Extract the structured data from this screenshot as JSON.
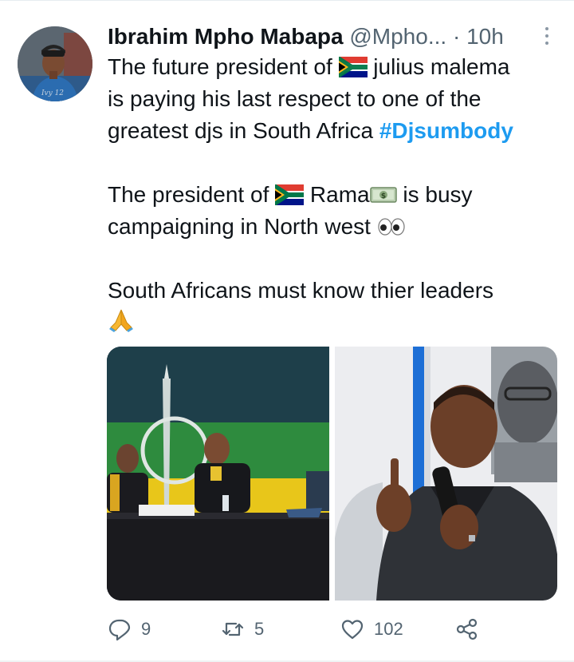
{
  "tweet": {
    "author_name": "Ibrahim Mpho Mabapa",
    "author_handle": "@Mpho...",
    "separator": "·",
    "time": "10h",
    "line1_before": "The future president of",
    "line1_after": "julius malema",
    "line2": "is paying his last respect to one of the",
    "line3_before": "greatest djs in South Africa",
    "hashtag": "#Djsumbody",
    "line4_before": "The president of",
    "line4_mid": "Rama",
    "line4_after": "is busy",
    "line5": "campaigning in North west",
    "line6": "South Africans must know thier leaders"
  },
  "emoji": {
    "flag": "south-africa-flag-icon",
    "money": "dollar-banknote-icon",
    "eyes": "eyes-icon",
    "pray": "folded-hands-icon"
  },
  "actions": {
    "replies": "9",
    "retweets": "5",
    "likes": "102"
  },
  "colors": {
    "text": "#0f1419",
    "secondary": "#536471",
    "link": "#1d9bf0",
    "divider": "#e6ecf0"
  }
}
